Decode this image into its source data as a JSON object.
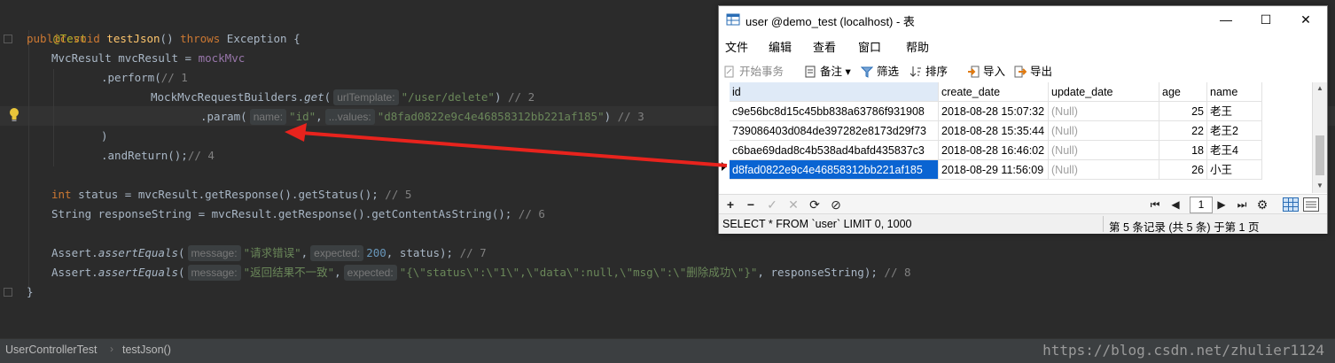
{
  "editor": {
    "lines": {
      "l1": "@Test",
      "l2_kw1": "public",
      "l2_kw2": "void",
      "l2_fn": "testJson",
      "l2_mid": "() ",
      "l2_kw3": "throws",
      "l2_rest": " Exception {",
      "l3_a": "MvcResult mvcResult = ",
      "l3_b": "mockMvc",
      "l4_a": ".perform(",
      "l4_c": "// 1",
      "l5_a": "MockMvcRequestBuilders.",
      "l5_b": "get",
      "l5_c": "(",
      "l5_hint": "urlTemplate:",
      "l5_str": "\"/user/delete\"",
      "l5_d": ") ",
      "l5_cmt": "// 2",
      "l6_a": ".param(",
      "l6_hint1": "name:",
      "l6_str1": "\"id\"",
      "l6_comma": ",",
      "l6_hint2": "...values:",
      "l6_str2": "\"d8fad0822e9c4e46858312bb221af185\"",
      "l6_d": ") ",
      "l6_cmt": "// 3",
      "l7": ")",
      "l8_a": ".andReturn();",
      "l8_cmt": "// 4",
      "l9_kw": "int",
      "l9_a": " status = mvcResult.getResponse().getStatus();",
      "l9_cmt": " // 5",
      "l10_a": "String responseString = mvcResult.getResponse().getContentAsString();",
      "l10_cmt": " // 6",
      "l11_a": "Assert.",
      "l11_b": "assertEquals",
      "l11_c": "(",
      "l11_hint1": "message:",
      "l11_str": "\"请求错误\"",
      "l11_comma": ",",
      "l11_hint2": "expected:",
      "l11_num": "200",
      "l11_d": ", status);",
      "l11_cmt": " // 7",
      "l12_a": "Assert.",
      "l12_b": "assertEquals",
      "l12_c": "(",
      "l12_hint1": "message:",
      "l12_str": "\"返回结果不一致\"",
      "l12_comma": ",",
      "l12_hint2": "expected:",
      "l12_str2": "\"{\\\"status\\\":\\\"1\\\",\\\"data\\\":null,\\\"msg\\\":\\\"删除成功\\\"}\"",
      "l12_d": ", responseString);",
      "l12_cmt": " // 8",
      "l13": "}"
    }
  },
  "breadcrumb": {
    "class_name": "UserControllerTest",
    "separator": "›",
    "method_name": "testJson()"
  },
  "watermark": "https://blog.csdn.net/zhulier1124",
  "window": {
    "title": "user @demo_test (localhost) - 表",
    "controls": {
      "minimize": "—",
      "maximize": "☐",
      "close": "✕"
    },
    "menu": [
      "文件",
      "编辑",
      "查看",
      "窗口",
      "帮助"
    ],
    "toolbar": {
      "begin_tx": "开始事务",
      "memo": "备注",
      "filter": "筛选",
      "sort": "排序",
      "import": "导入",
      "export": "导出"
    },
    "columns": [
      "id",
      "create_date",
      "update_date",
      "age",
      "name"
    ],
    "rows": [
      [
        "c9e56bc8d15c45bb838a63786f931908",
        "2018-08-28 15:07:32",
        "(Null)",
        "25",
        "老王"
      ],
      [
        "739086403d084de397282e8173d29f73",
        "2018-08-28 15:35:44",
        "(Null)",
        "22",
        "老王2"
      ],
      [
        "c6bae69dad8c4b538ad4bafd435837c3",
        "2018-08-28 16:46:02",
        "(Null)",
        "18",
        "老王4"
      ],
      [
        "d8fad0822e9c4e46858312bb221af185",
        "2018-08-29 11:56:09",
        "(Null)",
        "26",
        "小王"
      ]
    ],
    "nav": {
      "add": "+",
      "remove": "−",
      "apply": "✓",
      "discard": "✕",
      "refresh": "⟳",
      "stop": "⊘",
      "first": "⏮",
      "prev": "◀",
      "page": "1",
      "next": "▶",
      "last": "⏭",
      "settings": "⚙"
    },
    "status_sql": "SELECT * FROM `user` LIMIT 0, 1000",
    "status_records": "第 5 条记录 (共 5 条) 于第 1 页"
  },
  "colors": {
    "editor_bg": "#2b2b2b",
    "keyword": "#cc7832",
    "string": "#6a8759",
    "selection": "#0a64d2",
    "arrow": "#e8231d"
  }
}
